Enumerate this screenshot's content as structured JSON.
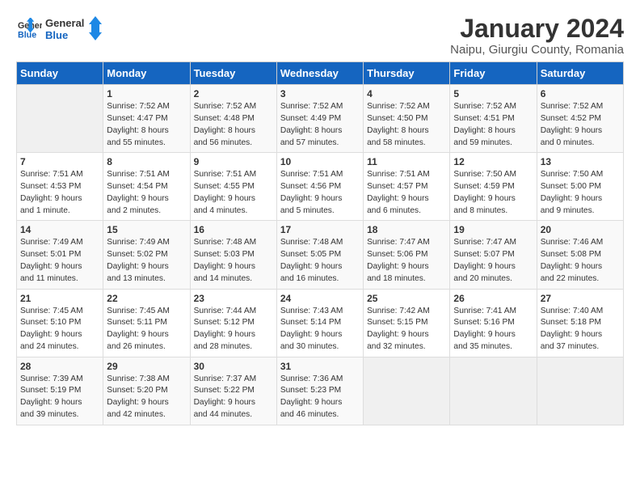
{
  "logo": {
    "line1": "General",
    "line2": "Blue"
  },
  "title": "January 2024",
  "subtitle": "Naipu, Giurgiu County, Romania",
  "days": [
    "Sunday",
    "Monday",
    "Tuesday",
    "Wednesday",
    "Thursday",
    "Friday",
    "Saturday"
  ],
  "weeks": [
    [
      {
        "date": "",
        "info": ""
      },
      {
        "date": "1",
        "info": "Sunrise: 7:52 AM\nSunset: 4:47 PM\nDaylight: 8 hours\nand 55 minutes."
      },
      {
        "date": "2",
        "info": "Sunrise: 7:52 AM\nSunset: 4:48 PM\nDaylight: 8 hours\nand 56 minutes."
      },
      {
        "date": "3",
        "info": "Sunrise: 7:52 AM\nSunset: 4:49 PM\nDaylight: 8 hours\nand 57 minutes."
      },
      {
        "date": "4",
        "info": "Sunrise: 7:52 AM\nSunset: 4:50 PM\nDaylight: 8 hours\nand 58 minutes."
      },
      {
        "date": "5",
        "info": "Sunrise: 7:52 AM\nSunset: 4:51 PM\nDaylight: 8 hours\nand 59 minutes."
      },
      {
        "date": "6",
        "info": "Sunrise: 7:52 AM\nSunset: 4:52 PM\nDaylight: 9 hours\nand 0 minutes."
      }
    ],
    [
      {
        "date": "7",
        "info": "Sunrise: 7:51 AM\nSunset: 4:53 PM\nDaylight: 9 hours\nand 1 minute."
      },
      {
        "date": "8",
        "info": "Sunrise: 7:51 AM\nSunset: 4:54 PM\nDaylight: 9 hours\nand 2 minutes."
      },
      {
        "date": "9",
        "info": "Sunrise: 7:51 AM\nSunset: 4:55 PM\nDaylight: 9 hours\nand 4 minutes."
      },
      {
        "date": "10",
        "info": "Sunrise: 7:51 AM\nSunset: 4:56 PM\nDaylight: 9 hours\nand 5 minutes."
      },
      {
        "date": "11",
        "info": "Sunrise: 7:51 AM\nSunset: 4:57 PM\nDaylight: 9 hours\nand 6 minutes."
      },
      {
        "date": "12",
        "info": "Sunrise: 7:50 AM\nSunset: 4:59 PM\nDaylight: 9 hours\nand 8 minutes."
      },
      {
        "date": "13",
        "info": "Sunrise: 7:50 AM\nSunset: 5:00 PM\nDaylight: 9 hours\nand 9 minutes."
      }
    ],
    [
      {
        "date": "14",
        "info": "Sunrise: 7:49 AM\nSunset: 5:01 PM\nDaylight: 9 hours\nand 11 minutes."
      },
      {
        "date": "15",
        "info": "Sunrise: 7:49 AM\nSunset: 5:02 PM\nDaylight: 9 hours\nand 13 minutes."
      },
      {
        "date": "16",
        "info": "Sunrise: 7:48 AM\nSunset: 5:03 PM\nDaylight: 9 hours\nand 14 minutes."
      },
      {
        "date": "17",
        "info": "Sunrise: 7:48 AM\nSunset: 5:05 PM\nDaylight: 9 hours\nand 16 minutes."
      },
      {
        "date": "18",
        "info": "Sunrise: 7:47 AM\nSunset: 5:06 PM\nDaylight: 9 hours\nand 18 minutes."
      },
      {
        "date": "19",
        "info": "Sunrise: 7:47 AM\nSunset: 5:07 PM\nDaylight: 9 hours\nand 20 minutes."
      },
      {
        "date": "20",
        "info": "Sunrise: 7:46 AM\nSunset: 5:08 PM\nDaylight: 9 hours\nand 22 minutes."
      }
    ],
    [
      {
        "date": "21",
        "info": "Sunrise: 7:45 AM\nSunset: 5:10 PM\nDaylight: 9 hours\nand 24 minutes."
      },
      {
        "date": "22",
        "info": "Sunrise: 7:45 AM\nSunset: 5:11 PM\nDaylight: 9 hours\nand 26 minutes."
      },
      {
        "date": "23",
        "info": "Sunrise: 7:44 AM\nSunset: 5:12 PM\nDaylight: 9 hours\nand 28 minutes."
      },
      {
        "date": "24",
        "info": "Sunrise: 7:43 AM\nSunset: 5:14 PM\nDaylight: 9 hours\nand 30 minutes."
      },
      {
        "date": "25",
        "info": "Sunrise: 7:42 AM\nSunset: 5:15 PM\nDaylight: 9 hours\nand 32 minutes."
      },
      {
        "date": "26",
        "info": "Sunrise: 7:41 AM\nSunset: 5:16 PM\nDaylight: 9 hours\nand 35 minutes."
      },
      {
        "date": "27",
        "info": "Sunrise: 7:40 AM\nSunset: 5:18 PM\nDaylight: 9 hours\nand 37 minutes."
      }
    ],
    [
      {
        "date": "28",
        "info": "Sunrise: 7:39 AM\nSunset: 5:19 PM\nDaylight: 9 hours\nand 39 minutes."
      },
      {
        "date": "29",
        "info": "Sunrise: 7:38 AM\nSunset: 5:20 PM\nDaylight: 9 hours\nand 42 minutes."
      },
      {
        "date": "30",
        "info": "Sunrise: 7:37 AM\nSunset: 5:22 PM\nDaylight: 9 hours\nand 44 minutes."
      },
      {
        "date": "31",
        "info": "Sunrise: 7:36 AM\nSunset: 5:23 PM\nDaylight: 9 hours\nand 46 minutes."
      },
      {
        "date": "",
        "info": ""
      },
      {
        "date": "",
        "info": ""
      },
      {
        "date": "",
        "info": ""
      }
    ]
  ]
}
